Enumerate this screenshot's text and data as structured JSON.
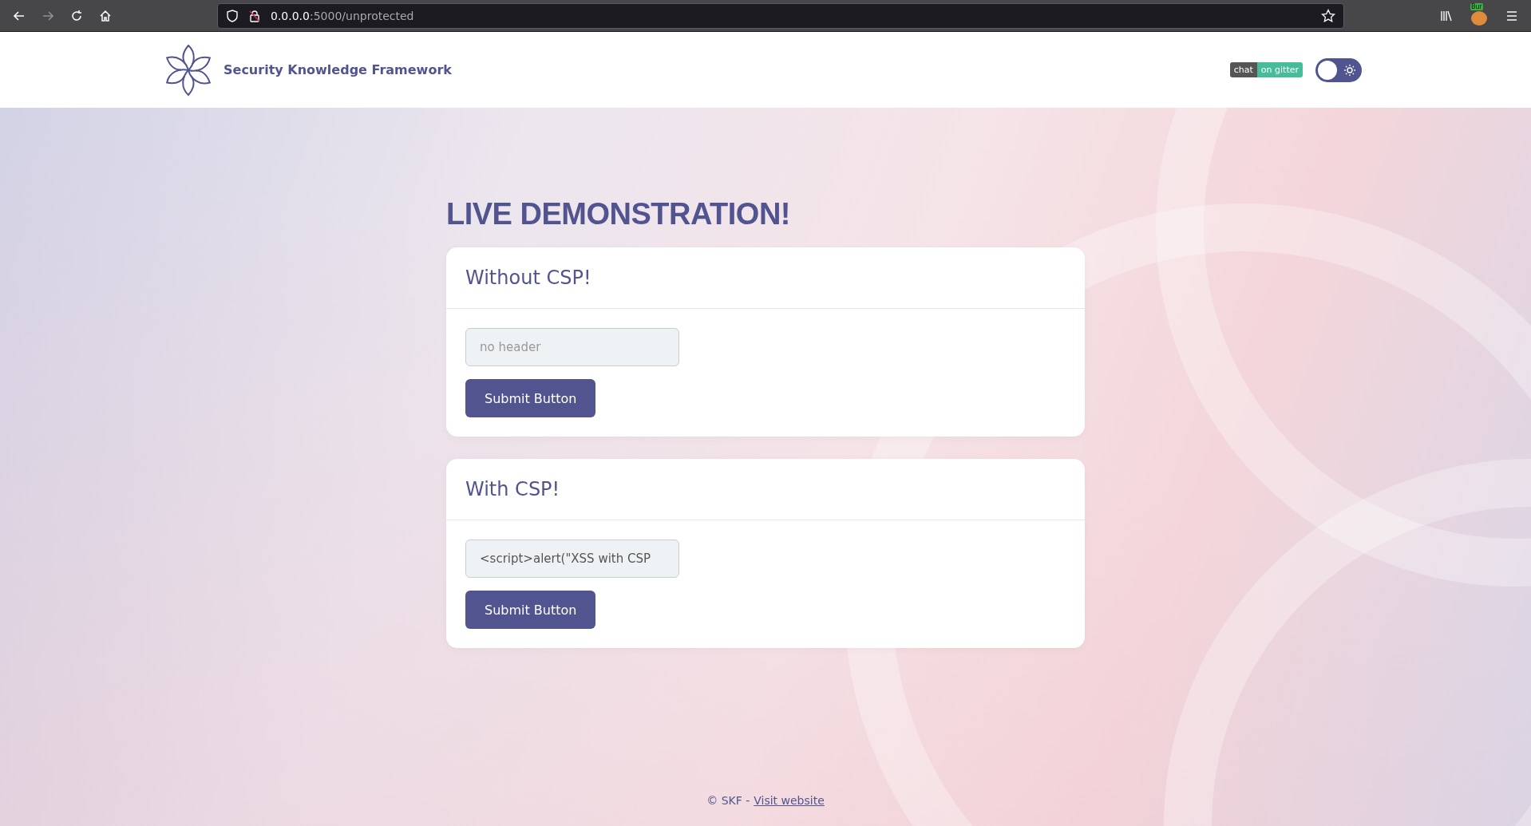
{
  "browser": {
    "url_host": "0.0.0.0",
    "url_path": ":5000/unprotected",
    "extension_badge": "Bur"
  },
  "header": {
    "brand": "Security Knowledge Framework",
    "chat_badge": {
      "left": "chat",
      "right": "on gitter"
    },
    "theme_toggle": {
      "on": false
    }
  },
  "page_title": "LIVE DEMONSTRATION!",
  "cards": [
    {
      "title": "Without CSP!",
      "input": {
        "placeholder": "no header"
      },
      "button": "Submit Button"
    },
    {
      "title": "With CSP!",
      "input": {
        "value": "<script>alert(\"XSS with CSP"
      },
      "button": "Submit Button"
    }
  ],
  "footer": {
    "text": "© SKF -",
    "link": "Visit website"
  }
}
